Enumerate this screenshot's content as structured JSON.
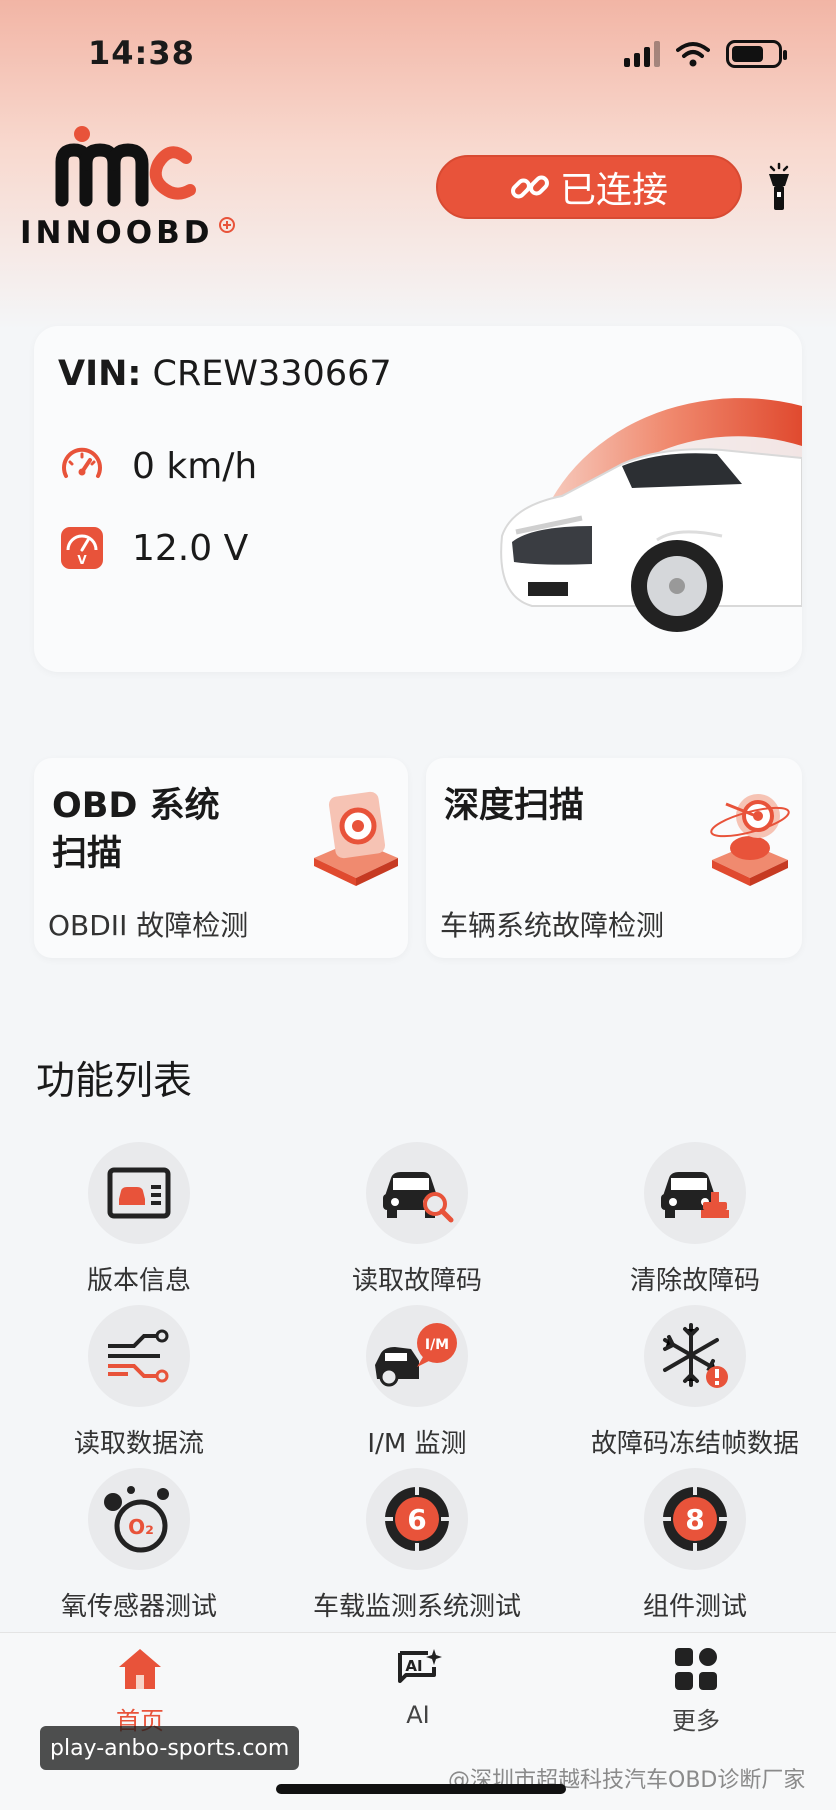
{
  "status_bar": {
    "time": "14:38"
  },
  "header": {
    "logo_text": "INNOOBD",
    "connect_label": "已连接",
    "colors": {
      "accent": "#e8533a"
    }
  },
  "vehicle": {
    "vin_label": "VIN:",
    "vin_value": "CREW330667",
    "speed": "0 km/h",
    "voltage": "12.0 V"
  },
  "scan_cards": [
    {
      "title_line1": "OBD 系统",
      "title_line2": "扫描",
      "subtitle": "OBDII 故障检测"
    },
    {
      "title_line1": "深度扫描",
      "title_line2": "",
      "subtitle": "车辆系统故障检测"
    }
  ],
  "functions": {
    "title": "功能列表",
    "items": [
      {
        "label": "版本信息",
        "icon": "id-card-icon"
      },
      {
        "label": "读取故障码",
        "icon": "car-search-icon"
      },
      {
        "label": "清除故障码",
        "icon": "car-clear-icon"
      },
      {
        "label": "读取数据流",
        "icon": "data-stream-icon"
      },
      {
        "label": "I/M 监测",
        "icon": "im-monitor-icon"
      },
      {
        "label": "故障码冻结帧数据",
        "icon": "freeze-frame-icon"
      },
      {
        "label": "氧传感器测试",
        "icon": "o2-sensor-icon"
      },
      {
        "label": "车载监测系统测试",
        "icon": "onboard-monitor-6-icon"
      },
      {
        "label": "组件测试",
        "icon": "component-test-8-icon"
      }
    ]
  },
  "bottom_nav": [
    {
      "label": "首页",
      "icon": "home-icon",
      "active": true
    },
    {
      "label": "AI",
      "icon": "ai-chat-icon",
      "active": false
    },
    {
      "label": "更多",
      "icon": "grid-more-icon",
      "active": false
    }
  ],
  "watermarks": {
    "left": "play-anbo-sports.com",
    "right": "@深圳市超越科技汽车OBD诊断厂家"
  }
}
